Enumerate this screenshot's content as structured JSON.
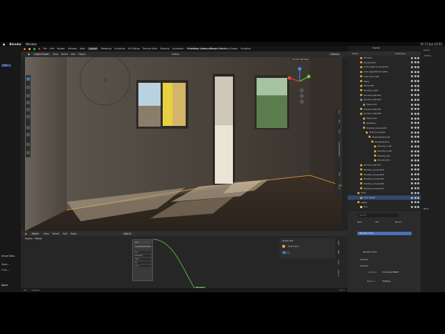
{
  "menubar": {
    "app": "Blender",
    "window": "Window",
    "clock": "Fri 17 Jan 12:51"
  },
  "left_panel": {
    "top_label": "Mat...",
    "item1": "Smart Bins",
    "item2": "Vega...",
    "item3": "Colo...",
    "item4": "DevV"
  },
  "topbar": {
    "menus": [
      "File",
      "Edit",
      "Render",
      "Window",
      "Help"
    ],
    "workspaces": [
      "Layout",
      "Modeling",
      "Sculpting",
      "UV Editing",
      "Texture Paint",
      "Shading",
      "Animation",
      "Rendering",
      "Compositing",
      "Geometry Nodes",
      "Scripting"
    ],
    "title": "* Untitled.blend - Blender 5.0.1",
    "scene_label": "Scene",
    "viewlayer_label": "ViewLayer"
  },
  "viewport_header": {
    "mode": "Object Mode",
    "view": "View",
    "select": "Select",
    "add": "Add",
    "object": "Object",
    "orientation": "Global",
    "options": "Options",
    "popup": "Screencast Keys"
  },
  "viewport_tabs": [
    "Item",
    "Tool",
    "View",
    "Screencast Keys",
    "Edit",
    "Create"
  ],
  "node_editor": {
    "type_label": "World",
    "menus": [
      "View",
      "Select",
      "Add",
      "Node"
    ],
    "world_field": "World",
    "breadcrumb_scene": "Scene",
    "breadcrumb_world": "World",
    "node_rows": [
      "Color",
      "Hue/Saturation/Value",
      "Hue",
      "Saturation",
      "Value",
      "Fac",
      "Color"
    ],
    "node_footer": "Mix Color",
    "active_tool_title": "Active Tool",
    "active_tool_name": "Select Box",
    "side_tabs": [
      "Node",
      "Tool",
      "View",
      "Options"
    ]
  },
  "footer": {
    "left1": "Pan",
    "left2": "Options",
    "version": "5.0.1"
  },
  "outliner": {
    "rows": [
      {
        "label": "Window_",
        "sel": false,
        "icon": "#d49b3c"
      },
      {
        "label": "Handle.013",
        "sel": false,
        "icon": "#d49b3c"
      },
      {
        "label": "room walls for projector",
        "sel": false,
        "icon": "#d49b3c"
      },
      {
        "label": "main appartment walls",
        "sel": false,
        "icon": "#d49b3c"
      },
      {
        "label": "main door wall",
        "sel": false,
        "icon": "#d49b3c"
      },
      {
        "label": "Plane",
        "sel": false,
        "icon": "#d49b3c"
      },
      {
        "label": "Plane.002",
        "sel": false,
        "icon": "#d49b3c"
      },
      {
        "label": "Window_L005",
        "sel": false,
        "icon": "#d49b3c"
      },
      {
        "label": "window wall.003",
        "sel": false,
        "icon": "#d49b3c"
      },
      {
        "label": "window wall.004",
        "sel": false,
        "icon": "#888888"
      },
      {
        "label": "Plane.013",
        "sel": false,
        "icon": "#888888"
      },
      {
        "label": "window wall.005",
        "sel": false,
        "icon": "#d49b3c"
      },
      {
        "label": "window wall.002",
        "sel": false,
        "icon": "#d49b3c"
      },
      {
        "label": "Plane.003",
        "sel": false,
        "icon": "#d49b3c"
      },
      {
        "label": "Modifiers",
        "sel": false,
        "icon": "#5a8ed6"
      },
      {
        "label": "Window_Group.003",
        "sel": false,
        "icon": "#d49b3c"
      },
      {
        "label": "STB_Group.003",
        "sel": false,
        "icon": "#d49b3c"
      },
      {
        "label": "WindowFrame.00",
        "sel": false,
        "icon": "#d49b3c"
      },
      {
        "label": "WindowFrame",
        "sel": false,
        "icon": "#d49b3c"
      },
      {
        "label": "Window_L.00",
        "sel": false,
        "icon": "#d49b3c"
      },
      {
        "label": "Window_G.00",
        "sel": false,
        "icon": "#d49b3c"
      },
      {
        "label": "Window_S0...",
        "sel": false,
        "icon": "#d49b3c"
      },
      {
        "label": "Window_S0...",
        "sel": false,
        "icon": "#d49b3c"
      },
      {
        "label": "window wall.001",
        "sel": false,
        "icon": "#d49b3c"
      },
      {
        "label": "Window_Group.003",
        "sel": false,
        "icon": "#d49b3c"
      },
      {
        "label": "Window_Group.004",
        "sel": false,
        "icon": "#d49b3c"
      },
      {
        "label": "Window_Group.005",
        "sel": false,
        "icon": "#d49b3c"
      },
      {
        "label": "Window_Group.006",
        "sel": false,
        "icon": "#d49b3c"
      },
      {
        "label": "Window_Group.007",
        "sel": false,
        "icon": "#d49b3c"
      },
      {
        "label": "Floor",
        "sel": false,
        "icon": "#d49b3c"
      },
      {
        "label": "floor tablet",
        "sel": true,
        "icon": "#d49b3c"
      },
      {
        "label": "Lights",
        "sel": false,
        "icon": "#d49b3c"
      },
      {
        "label": "Sun",
        "sel": false,
        "icon": "#e8d25a"
      }
    ]
  },
  "properties": {
    "search_placeholder": "Search",
    "material_tabs": [
      "New",
      "Pre",
      "Wood..."
    ],
    "slot": "Wooden Floor",
    "material_name": "Wooden Floor",
    "sections": [
      "Preview",
      "Surface"
    ],
    "surface_label": "Surface",
    "surface_value": "Principled BSDF",
    "base_color_label": "Base C...",
    "base_color_value": "Multiply"
  },
  "right_panel": {
    "label1": "pector",
    "label2": "_Extern",
    "label3": "(Billi)"
  }
}
